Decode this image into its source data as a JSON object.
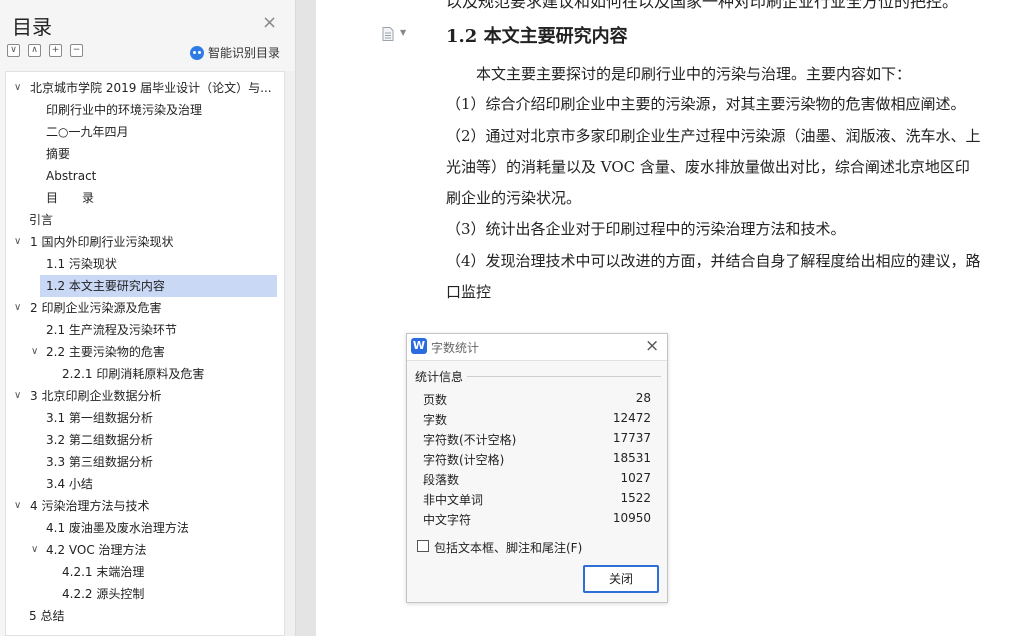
{
  "nav": {
    "title": "目录",
    "smart_label": "智能识别目录",
    "items": [
      {
        "label": "北京城市学院 2019 届毕业设计（论文）与...",
        "arrow": "∨"
      },
      {
        "label": "印刷行业中的环境污染及治理",
        "arrow": ""
      },
      {
        "label": "二○一九年四月",
        "arrow": ""
      },
      {
        "label": "摘要",
        "arrow": ""
      },
      {
        "label": "Abstract",
        "arrow": ""
      },
      {
        "label": "目　　录",
        "arrow": ""
      },
      {
        "label": "引言",
        "arrow": ""
      },
      {
        "label": "1  国内外印刷行业污染现状",
        "arrow": "∨"
      },
      {
        "label": "1.1 污染现状",
        "arrow": ""
      },
      {
        "label": "1.2 本文主要研究内容",
        "arrow": ""
      },
      {
        "label": "2  印刷企业污染源及危害",
        "arrow": "∨"
      },
      {
        "label": "2.1 生产流程及污染环节",
        "arrow": ""
      },
      {
        "label": "2.2 主要污染物的危害",
        "arrow": "∨"
      },
      {
        "label": "2.2.1 印刷消耗原料及危害",
        "arrow": ""
      },
      {
        "label": "3  北京印刷企业数据分析",
        "arrow": "∨"
      },
      {
        "label": "3.1 第一组数据分析",
        "arrow": ""
      },
      {
        "label": "3.2 第二组数据分析",
        "arrow": ""
      },
      {
        "label": "3.3 第三组数据分析",
        "arrow": ""
      },
      {
        "label": "3.4 小结",
        "arrow": ""
      },
      {
        "label": "4  污染治理方法与技术",
        "arrow": "∨"
      },
      {
        "label": "4.1 废油墨及废水治理方法",
        "arrow": ""
      },
      {
        "label": "4.2 VOC 治理方法",
        "arrow": "∨"
      },
      {
        "label": "4.2.1 末端治理",
        "arrow": ""
      },
      {
        "label": "4.2.2 源头控制",
        "arrow": ""
      },
      {
        "label": "5  总结",
        "arrow": ""
      }
    ]
  },
  "doc": {
    "top_fragment": "以及规范要求建议和如何在以及国家一种对印刷企业行业全方位的把控。",
    "heading": "1.2 本文主要研究内容",
    "paragraphs": [
      "　　本文主要主要探讨的是印刷行业中的污染与治理。主要内容如下：",
      "（1）综合介绍印刷企业中主要的污染源，对其主要污染物的危害做相应阐述。",
      "（2）通过对北京市多家印刷企业生产过程中污染源（油墨、润版液、洗车水、上",
      "光油等）的消耗量以及 VOC 含量、废水排放量做出对比，综合阐述北京地区印",
      "刷企业的污染状况。",
      "（3）统计出各企业对于印刷过程中的污染治理方法和技术。",
      "（4）发现治理技术中可以改进的方面，并结合自身了解程度给出相应的建议，路",
      "口监控"
    ]
  },
  "dialog": {
    "logo": "W",
    "title": "字数统计",
    "section": "统计信息",
    "stats": [
      {
        "label": "页数",
        "value": "28"
      },
      {
        "label": "字数",
        "value": "12472"
      },
      {
        "label": "字符数(不计空格)",
        "value": "17737"
      },
      {
        "label": "字符数(计空格)",
        "value": "18531"
      },
      {
        "label": "段落数",
        "value": "1027"
      },
      {
        "label": "非中文单词",
        "value": "1522"
      },
      {
        "label": "中文字符",
        "value": "10950"
      }
    ],
    "checkbox_label": "包括文本框、脚注和尾注(F)",
    "close_button": "关闭"
  }
}
